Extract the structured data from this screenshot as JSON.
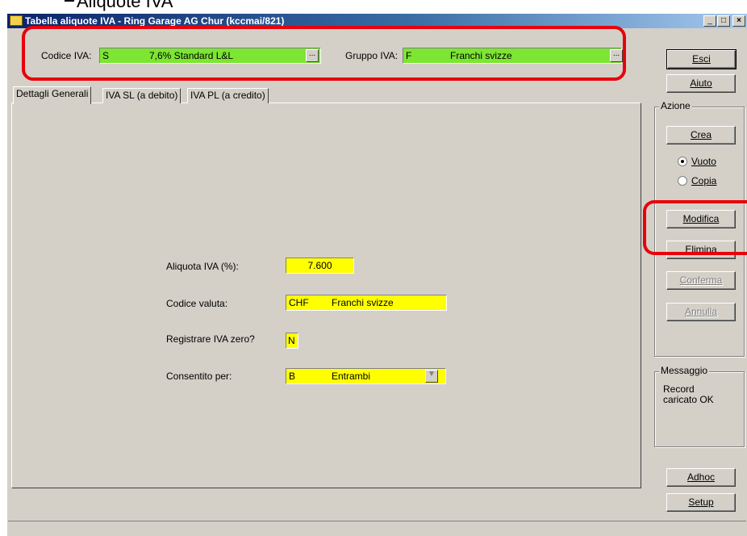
{
  "slide": {
    "title": "Aliquote IVA"
  },
  "window": {
    "title": "Tabella aliquote IVA - Ring Garage AG Chur (kccmai/821)"
  },
  "header": {
    "codice_label": "Codice IVA:",
    "codice_code": "S",
    "codice_desc": "7,6% Standard L&L",
    "gruppo_label": "Gruppo IVA:",
    "gruppo_code": "F",
    "gruppo_desc": "Franchi svizze",
    "lookup": "..."
  },
  "tabs": [
    {
      "label": "Dettagli Generali"
    },
    {
      "label": "IVA SL (a debito)"
    },
    {
      "label": "IVA PL (a credito)"
    }
  ],
  "form": {
    "aliquota_label": "Aliquota IVA (%):",
    "aliquota_value": "7.600",
    "valuta_label": "Codice valuta:",
    "valuta_code": "CHF",
    "valuta_desc": "Franchi svizze",
    "zero_label": "Registrare IVA zero?",
    "zero_value": "N",
    "consentito_label": "Consentito per:",
    "consentito_code": "B",
    "consentito_desc": "Entrambi"
  },
  "side": {
    "esci": "Esci",
    "aiuto": "Aiuto",
    "azione_title": "Azione",
    "crea": "Crea",
    "vuoto": "Vuoto",
    "copia": "Copia",
    "modifica": "Modifica",
    "elimina": "Elimina",
    "conferma": "Conferma",
    "annulla": "Annulla",
    "messaggio_title": "Messaggio",
    "messaggio_text": "Record caricato OK",
    "adhoc": "Adhoc",
    "setup": "Setup"
  },
  "colors": {
    "green_field": "#7ce632",
    "yellow_field": "#ffff00",
    "highlight": "#e8000b",
    "window_bg": "#d4d0c8"
  },
  "radio_selected": "vuoto"
}
